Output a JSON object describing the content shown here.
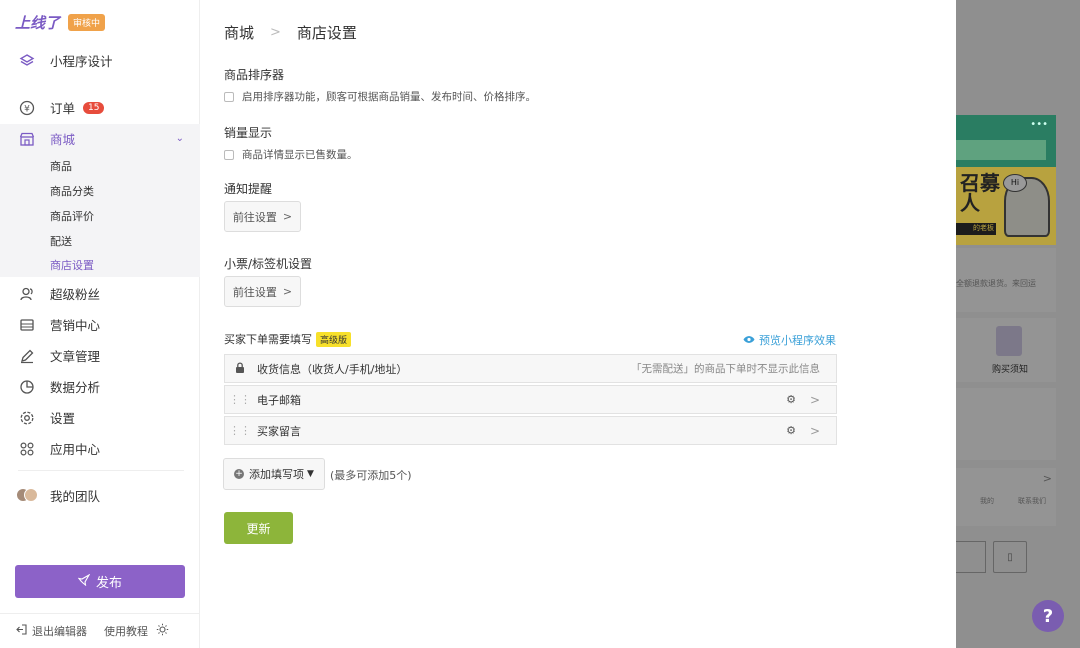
{
  "brand": {
    "logo": "上线了",
    "status_badge": "审核中"
  },
  "sidebar": {
    "design": "小程序设计",
    "orders": {
      "label": "订单",
      "badge": "15"
    },
    "mall": {
      "label": "商城",
      "sub_items": [
        "商品",
        "商品分类",
        "商品评价",
        "配送",
        "商店设置"
      ],
      "active_sub": "商店设置"
    },
    "items": [
      {
        "label": "超级粉丝",
        "icon": "fans-icon"
      },
      {
        "label": "营销中心",
        "icon": "marketing-icon"
      },
      {
        "label": "文章管理",
        "icon": "pen-icon"
      },
      {
        "label": "数据分析",
        "icon": "pie-chart-icon"
      },
      {
        "label": "设置",
        "icon": "gear-icon"
      },
      {
        "label": "应用中心",
        "icon": "apps-icon"
      }
    ],
    "team": "我的团队",
    "publish": "发布",
    "footer": {
      "exit": "退出编辑器",
      "tutorial": "使用教程"
    }
  },
  "breadcrumb": {
    "root": "商城",
    "current": "商店设置"
  },
  "sections": {
    "sorter": {
      "title": "商品排序器",
      "checkbox": "启用排序器功能，顾客可根据商品销量、发布时间、价格排序。",
      "checked": false
    },
    "sales": {
      "title": "销量显示",
      "checkbox": "商品详情显示已售数量。",
      "checked": false
    },
    "notify": {
      "title": "通知提醒",
      "button": "前往设置"
    },
    "printer": {
      "title": "小票/标签机设置",
      "button": "前往设置"
    }
  },
  "buyer_fields": {
    "title": "买家下单需要填写",
    "tag": "高级版",
    "preview": "预览小程序效果",
    "rows": [
      {
        "name": "收货信息（收货人/手机/地址）",
        "note": "「无需配送」的商品下单时不显示此信息"
      },
      {
        "name": "电子邮箱"
      },
      {
        "name": "买家留言"
      }
    ],
    "add_button": "添加填写项",
    "add_note": "(最多可添加5个)"
  },
  "update_button": "更新",
  "preview_panel": {
    "banner_text": "召募\n人",
    "banner_hi": "Hi",
    "banner_strip": "的老板",
    "body_text": "全额退款退货。来回运",
    "purchase_label": "购买须知",
    "tabs": [
      "我的",
      "联系我们"
    ]
  },
  "help": "?"
}
